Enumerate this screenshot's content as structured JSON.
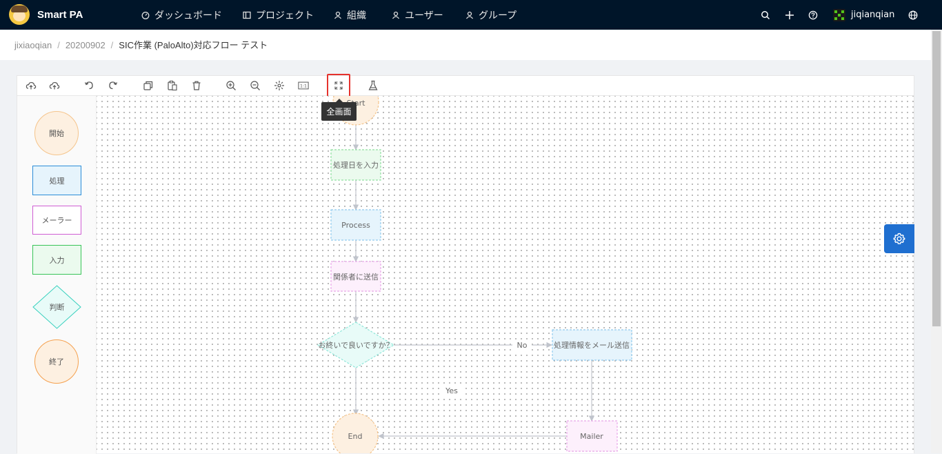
{
  "app": {
    "brand": "Smart PA"
  },
  "nav": {
    "dashboard": "ダッシュボード",
    "project": "プロジェクト",
    "org": "組織",
    "user": "ユーザー",
    "group": "グループ"
  },
  "header_right": {
    "username": "jiqianqian"
  },
  "breadcrumb": {
    "items": [
      "jixiaoqian",
      "20200902",
      "SIC作業 (PaloAlto)対応フロー テスト"
    ]
  },
  "toolbar": {
    "tooltip": "全画面"
  },
  "palette": {
    "start": "開始",
    "process": "処理",
    "mailer": "メーラー",
    "input": "入力",
    "decision": "判断",
    "end": "終了"
  },
  "flow": {
    "start": "Start",
    "input_date": "処理日を入力",
    "process": "Process",
    "send_related": "関係者に送信",
    "decision": "お終いで良いですか？",
    "no_label": "No",
    "yes_label": "Yes",
    "mail_info": "処理情報をメール送信",
    "mailer": "Mailer",
    "end": "End"
  },
  "colors": {
    "nav_bg": "#001529",
    "accent_blue": "#1f6fd0",
    "highlight_red": "#e5322d",
    "start_fill": "#fdf0e1",
    "start_stroke": "#f5c48b",
    "process_fill": "#e6f4fc",
    "process_stroke": "#91cbee",
    "mailer_fill": "#fdf0fc",
    "mailer_stroke": "#e8a6e8",
    "input_fill": "#ebfaee",
    "input_stroke": "#8fe0a0",
    "decision_fill": "#e8fbf8",
    "decision_stroke": "#8ee6d9"
  }
}
